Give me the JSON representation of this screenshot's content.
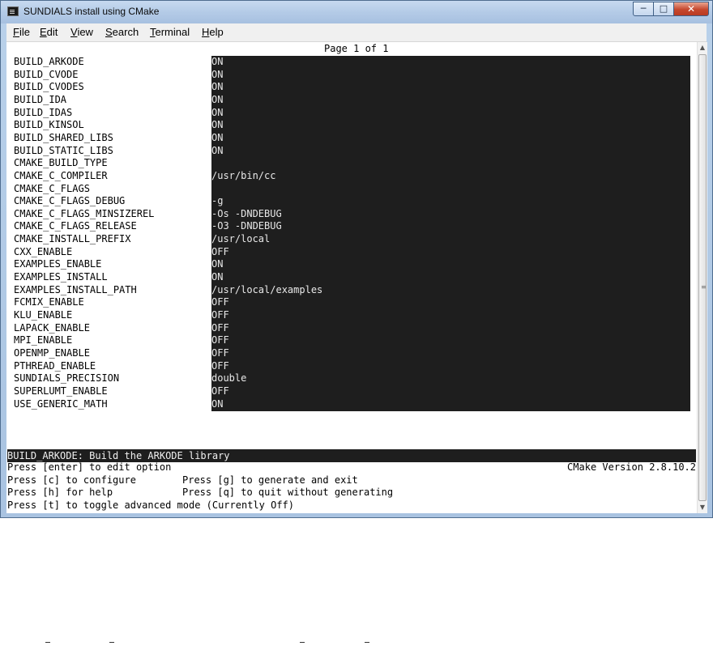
{
  "window": {
    "title": "SUNDIALS install using CMake",
    "controls": {
      "minimize": "─",
      "maximize": "□",
      "close": "✕"
    }
  },
  "menu": [
    {
      "accel": "F",
      "rest": "ile"
    },
    {
      "accel": "E",
      "rest": "dit"
    },
    {
      "accel": "V",
      "rest": "iew"
    },
    {
      "accel": "S",
      "rest": "earch"
    },
    {
      "accel": "T",
      "rest": "erminal"
    },
    {
      "accel": "H",
      "rest": "elp"
    }
  ],
  "terminal": {
    "page_indicator": "Page 1 of 1",
    "options": [
      {
        "key": "BUILD_ARKODE",
        "value": "ON"
      },
      {
        "key": "BUILD_CVODE",
        "value": "ON"
      },
      {
        "key": "BUILD_CVODES",
        "value": "ON"
      },
      {
        "key": "BUILD_IDA",
        "value": "ON"
      },
      {
        "key": "BUILD_IDAS",
        "value": "ON"
      },
      {
        "key": "BUILD_KINSOL",
        "value": "ON"
      },
      {
        "key": "BUILD_SHARED_LIBS",
        "value": "ON"
      },
      {
        "key": "BUILD_STATIC_LIBS",
        "value": "ON"
      },
      {
        "key": "CMAKE_BUILD_TYPE",
        "value": ""
      },
      {
        "key": "CMAKE_C_COMPILER",
        "value": "/usr/bin/cc"
      },
      {
        "key": "CMAKE_C_FLAGS",
        "value": ""
      },
      {
        "key": "CMAKE_C_FLAGS_DEBUG",
        "value": "-g"
      },
      {
        "key": "CMAKE_C_FLAGS_MINSIZEREL",
        "value": "-Os -DNDEBUG"
      },
      {
        "key": "CMAKE_C_FLAGS_RELEASE",
        "value": "-O3 -DNDEBUG"
      },
      {
        "key": "CMAKE_INSTALL_PREFIX",
        "value": "/usr/local"
      },
      {
        "key": "CXX_ENABLE",
        "value": "OFF"
      },
      {
        "key": "EXAMPLES_ENABLE",
        "value": "ON"
      },
      {
        "key": "EXAMPLES_INSTALL",
        "value": "ON"
      },
      {
        "key": "EXAMPLES_INSTALL_PATH",
        "value": "/usr/local/examples"
      },
      {
        "key": "FCMIX_ENABLE",
        "value": "OFF"
      },
      {
        "key": "KLU_ENABLE",
        "value": "OFF"
      },
      {
        "key": "LAPACK_ENABLE",
        "value": "OFF"
      },
      {
        "key": "MPI_ENABLE",
        "value": "OFF"
      },
      {
        "key": "OPENMP_ENABLE",
        "value": "OFF"
      },
      {
        "key": "PTHREAD_ENABLE",
        "value": "OFF"
      },
      {
        "key": "SUNDIALS_PRECISION",
        "value": "double"
      },
      {
        "key": "SUPERLUMT_ENABLE",
        "value": "OFF"
      },
      {
        "key": "USE_GENERIC_MATH",
        "value": "ON"
      }
    ],
    "status": "BUILD_ARKODE: Build the ARKODE library",
    "cmake_version": "CMake Version 2.8.10.2",
    "help": [
      {
        "left": "Press [enter] to edit option",
        "right": ""
      },
      {
        "left": "Press [c] to configure",
        "right": "Press [g] to generate and exit"
      },
      {
        "left": "Press [h] for help",
        "right": "Press [q] to quit without generating"
      },
      {
        "left": "Press [t] to toggle advanced mode (Currently Off)",
        "right": ""
      }
    ]
  },
  "scrollbar": {
    "up": "▲",
    "down": "▼",
    "grip": "≡"
  }
}
